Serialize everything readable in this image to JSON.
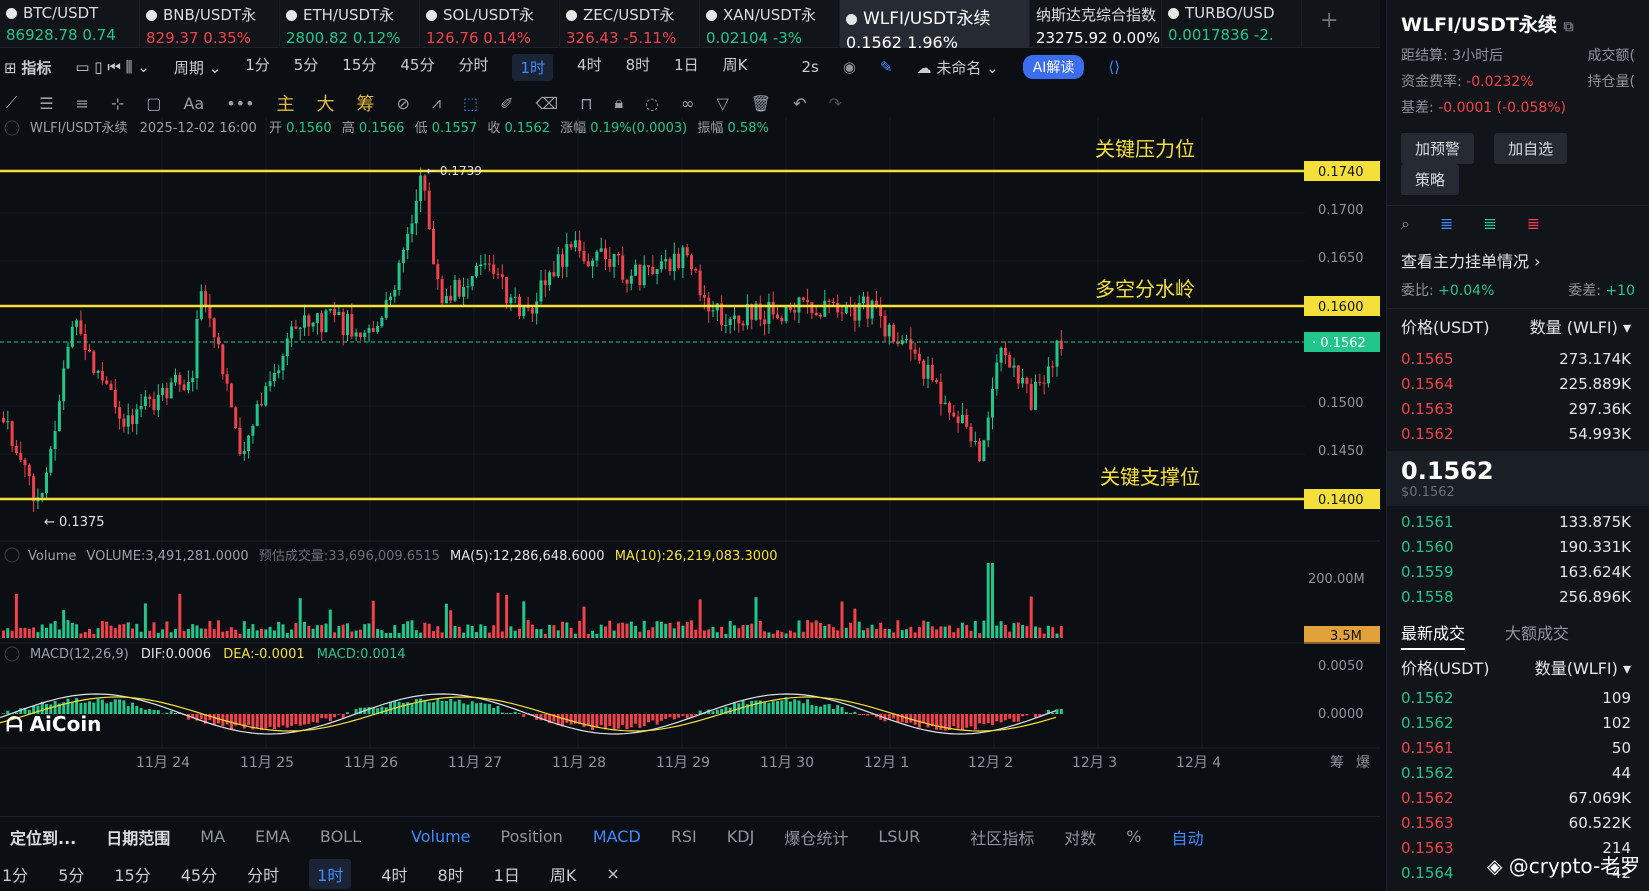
{
  "tickers": [
    {
      "symbol": "BTC/USDT",
      "price": "86928.78",
      "change": "0.74",
      "dir": "up"
    },
    {
      "symbol": "BNB/USDT永",
      "price": "829.37",
      "change": "0.35%",
      "dir": "dn"
    },
    {
      "symbol": "ETH/USDT永",
      "price": "2800.82",
      "change": "0.12%",
      "dir": "up"
    },
    {
      "symbol": "SOL/USDT永",
      "price": "126.76",
      "change": "0.14%",
      "dir": "dn"
    },
    {
      "symbol": "ZEC/USDT永",
      "price": "326.43",
      "change": "-5.11%",
      "dir": "dn"
    },
    {
      "symbol": "XAN/USDT永",
      "price": "0.02104",
      "change": "-3%",
      "dir": "up"
    },
    {
      "symbol": "WLFI/USDT永续",
      "price": "0.1562",
      "change": "1.96%",
      "dir": "active"
    },
    {
      "symbol": "纳斯达克综合指数",
      "price": "23275.92",
      "change": "0.00%",
      "dir": "white"
    },
    {
      "symbol": "TURBO/USD",
      "price": "0.0017836",
      "change": "-2.",
      "dir": "up"
    }
  ],
  "toolbar1": {
    "indicators": "指标",
    "period": "周期",
    "timeframes": [
      "1分",
      "5分",
      "15分",
      "45分",
      "分时",
      "1时",
      "4时",
      "8时",
      "1日",
      "周K"
    ],
    "selected_tf": "1时",
    "refresh": "2s",
    "layout_name": "未命名",
    "ai": "AI解读"
  },
  "toolbar2": {
    "labels": [
      "主",
      "大",
      "筹"
    ]
  },
  "chart_header": {
    "symbol": "WLFI/USDT永续",
    "datetime": "2025-12-02 16:00",
    "open_label": "开",
    "open": "0.1560",
    "high_label": "高",
    "high": "0.1566",
    "low_label": "低",
    "low": "0.1557",
    "close_label": "收",
    "close": "0.1562",
    "change_label": "涨幅",
    "change": "0.19%(0.0003)",
    "amp_label": "振幅",
    "amp": "0.58%"
  },
  "annotations": {
    "resistance": "关键压力位",
    "pivot": "多空分水岭",
    "support": "关键支撑位",
    "hi_mark": "0.1739",
    "lo_mark": "0.1375"
  },
  "price_axis": {
    "ticks": [
      "0.1700",
      "0.1650",
      "0.1500",
      "0.1450"
    ],
    "line_labels": [
      "0.1740",
      "0.1600",
      "0.1562",
      "0.1400"
    ],
    "vol_ticks": [
      "200.00M"
    ],
    "vol_label": "3.5M",
    "macd_ticks": [
      "0.0050",
      "0.0000"
    ]
  },
  "volume_header": {
    "label": "Volume",
    "volume": "VOLUME:3,491,281.0000",
    "estimate": "预估成交量:33,696,009.6515",
    "ma5": "MA(5):12,286,648.6000",
    "ma10": "MA(10):26,219,083.3000"
  },
  "macd_header": {
    "label": "MACD(12,26,9)",
    "dif": "DIF:0.0006",
    "dea": "DEA:-0.0001",
    "macd": "MACD:0.0014"
  },
  "watermark": "AiCoin",
  "dates": [
    "11月 24",
    "11月 25",
    "11月 26",
    "11月 27",
    "11月 28",
    "11月 29",
    "11月 30",
    "12月 1",
    "12月 2",
    "12月 3",
    "12月 4"
  ],
  "axis_corner": [
    "筹",
    "爆"
  ],
  "bottom1": [
    "定位到...",
    "日期范围",
    "MA",
    "EMA",
    "BOLL",
    "Volume",
    "Position",
    "MACD",
    "RSI",
    "KDJ",
    "爆仓统计",
    "LSUR",
    "社区指标",
    "对数",
    "%",
    "自动"
  ],
  "bottom2": [
    "1分",
    "5分",
    "15分",
    "45分",
    "分时",
    "1时",
    "4时",
    "8时",
    "1日",
    "周K",
    "×"
  ],
  "panel": {
    "title": "WLFI/USDT永续",
    "settle_label": "距结算:",
    "settle": "3小时后",
    "turnover_label": "成交额(",
    "funding_label": "资金费率:",
    "funding": "-0.0232%",
    "oi_label": "持仓量(",
    "basis_label": "基差:",
    "basis": "-0.0001 (-0.058%)",
    "buttons": [
      "加预警",
      "加自选",
      "策略"
    ],
    "book_link": "查看主力挂单情况",
    "ratio_label": "委比:",
    "ratio": "+0.04%",
    "diff_label": "委差:",
    "diff": "+10",
    "price_col": "价格(USDT)",
    "qty_col": "数量 (WLFI)",
    "asks": [
      [
        "0.1565",
        "273.174K"
      ],
      [
        "0.1564",
        "225.889K"
      ],
      [
        "0.1563",
        "297.36K"
      ],
      [
        "0.1562",
        "54.993K"
      ]
    ],
    "last": "0.1562",
    "last_usd": "$0.1562",
    "bids": [
      [
        "0.1561",
        "133.875K"
      ],
      [
        "0.1560",
        "190.331K"
      ],
      [
        "0.1559",
        "163.624K"
      ],
      [
        "0.1558",
        "256.896K"
      ]
    ],
    "trade_tab": "最新成交",
    "big_tab": "大额成交",
    "trade_price_col": "价格(USDT)",
    "trade_qty_col": "数量(WLFI)",
    "trades": [
      [
        "0.1562",
        "109",
        "up"
      ],
      [
        "0.1562",
        "102",
        "up"
      ],
      [
        "0.1561",
        "50",
        "dn"
      ],
      [
        "0.1562",
        "44",
        "up"
      ],
      [
        "0.1562",
        "67.069K",
        "dn"
      ],
      [
        "0.1563",
        "60.522K",
        "dn"
      ],
      [
        "0.1563",
        "214",
        "dn"
      ],
      [
        "0.1564",
        "42",
        "up"
      ],
      [
        "0.1563",
        "66",
        "dn"
      ]
    ],
    "credit": "@crypto-老罗"
  },
  "colors": {
    "up": "#22c58a",
    "down": "#f0424b",
    "level": "#f5e03b",
    "accent": "#3d8bff"
  }
}
